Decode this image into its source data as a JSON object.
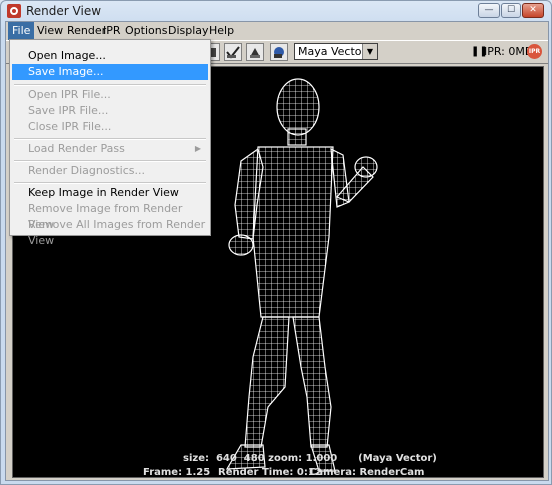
{
  "window": {
    "title": "Render View",
    "controls": {
      "minimize": "—",
      "maximize": "☐",
      "close": "✕"
    }
  },
  "menubar": {
    "items": [
      "File",
      "View",
      "Render",
      "IPR",
      "Options",
      "Display",
      "Help"
    ]
  },
  "toolbar": {
    "camera_select": "Maya Vector",
    "ipr_status": "IPR: 0MB",
    "ipr_badge": "IPR",
    "pause_glyph": "❚❚"
  },
  "file_menu": {
    "open_image": "Open Image...",
    "save_image": "Save Image...",
    "open_ipr": "Open IPR File...",
    "save_ipr": "Save IPR File...",
    "close_ipr": "Close IPR File...",
    "load_render_pass": "Load Render Pass",
    "render_diagnostics": "Render Diagnostics...",
    "keep_image": "Keep Image in Render View",
    "remove_image": "Remove Image from Render View",
    "remove_all": "Remove All Images from Render View"
  },
  "viewport": {
    "size_line": "size:  640  480 zoom: 1.000      (Maya Vector)",
    "frame": "Frame: 1.25",
    "render_time": "Render Time: 0:12",
    "camera": "Camera: RenderCam"
  },
  "colors": {
    "menu_highlight": "#3399ff",
    "active_menu": "#3a6ea5",
    "viewport_bg": "#000000",
    "wireframe": "#ffffff"
  }
}
